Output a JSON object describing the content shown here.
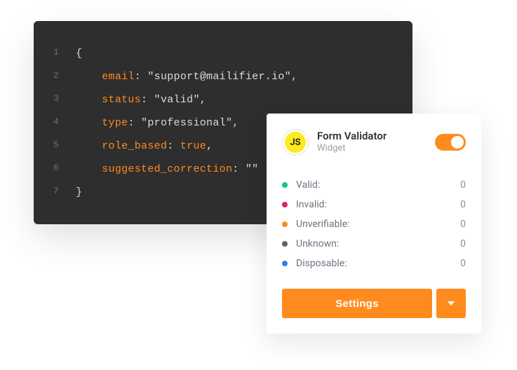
{
  "code": {
    "lines": [
      {
        "num": "1",
        "indent": "",
        "parts": [
          {
            "t": "punc",
            "v": "{"
          }
        ]
      },
      {
        "num": "2",
        "indent": "    ",
        "parts": [
          {
            "t": "key",
            "v": "email"
          },
          {
            "t": "punc",
            "v": ": "
          },
          {
            "t": "str",
            "v": "\"support@mailifier.io\""
          },
          {
            "t": "punc",
            "v": ","
          }
        ]
      },
      {
        "num": "3",
        "indent": "    ",
        "parts": [
          {
            "t": "key",
            "v": "status"
          },
          {
            "t": "punc",
            "v": ": "
          },
          {
            "t": "str",
            "v": "\"valid\""
          },
          {
            "t": "punc",
            "v": ","
          }
        ]
      },
      {
        "num": "4",
        "indent": "    ",
        "parts": [
          {
            "t": "key",
            "v": "type"
          },
          {
            "t": "punc",
            "v": ": "
          },
          {
            "t": "str",
            "v": "\"professional\""
          },
          {
            "t": "punc",
            "v": ","
          }
        ]
      },
      {
        "num": "5",
        "indent": "    ",
        "parts": [
          {
            "t": "key",
            "v": "role_based"
          },
          {
            "t": "punc",
            "v": ": "
          },
          {
            "t": "kw",
            "v": "true"
          },
          {
            "t": "punc",
            "v": ","
          }
        ]
      },
      {
        "num": "6",
        "indent": "    ",
        "parts": [
          {
            "t": "key",
            "v": "suggested_correction"
          },
          {
            "t": "punc",
            "v": ": "
          },
          {
            "t": "str",
            "v": "\"\""
          }
        ]
      },
      {
        "num": "7",
        "indent": "",
        "parts": [
          {
            "t": "punc",
            "v": "}"
          }
        ]
      }
    ]
  },
  "widget": {
    "icon_label": "JS",
    "title": "Form Validator",
    "subtitle": "Widget",
    "toggle_on": true,
    "stats": [
      {
        "label": "Valid:",
        "value": "0",
        "color": "#17c17a"
      },
      {
        "label": "Invalid:",
        "value": "0",
        "color": "#e61e5c"
      },
      {
        "label": "Unverifiable:",
        "value": "0",
        "color": "#ff8b1f"
      },
      {
        "label": "Unknown:",
        "value": "0",
        "color": "#5d6470"
      },
      {
        "label": "Disposable:",
        "value": "0",
        "color": "#2e7ff5"
      }
    ],
    "settings_label": "Settings"
  }
}
